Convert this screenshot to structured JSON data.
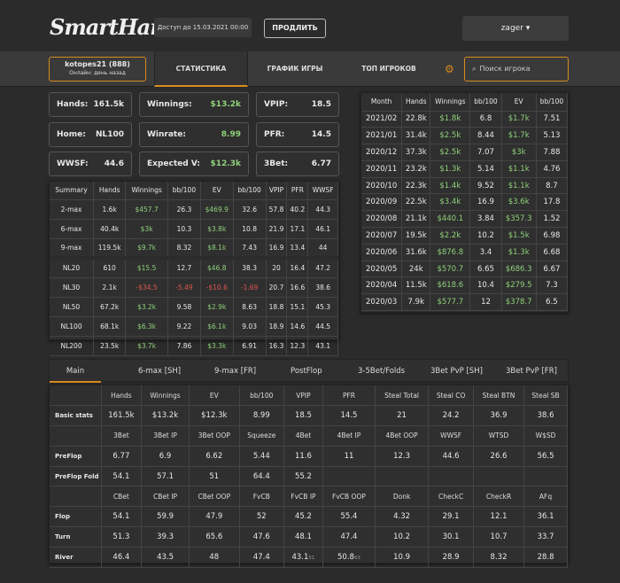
{
  "header": {
    "logo": "SmartHand",
    "access": "Доступ до 15.03.2021 00:00",
    "renew_label": "ПРОДЛИТЬ",
    "user": "zager ▾"
  },
  "nav": {
    "player_name": "kotopes21 (888)",
    "player_status": "Онлайн: день назад",
    "tabs": [
      "СТАТИСТИКА",
      "ГРАФИК ИГРЫ",
      "ТОП ИГРОКОВ"
    ],
    "search_placeholder": "Поиск игрока",
    "gear_icon": "gear-icon",
    "search_icon": "search-icon"
  },
  "stats": {
    "hands_label": "Hands:",
    "hands": "161.5k",
    "winnings_label": "Winnings:",
    "winnings": "$13.2k",
    "vpip_label": "VPIP:",
    "vpip": "18.5",
    "home_label": "Home:",
    "home": "NL100",
    "winrate_label": "Winrate:",
    "winrate": "8.99",
    "pfr_label": "PFR:",
    "pfr": "14.5",
    "wwsf_label": "WWSF:",
    "wwsf": "44.6",
    "expv_label": "Expected V:",
    "expv": "$12.3k",
    "threebet_label": "3Bet:",
    "threebet": "6.77"
  },
  "summary": {
    "headers": [
      "Summary",
      "Hands",
      "Winnings",
      "bb/100",
      "EV",
      "bb/100",
      "VPIP",
      "PFR",
      "WWSF"
    ],
    "rows": [
      [
        "2-max",
        "1.6k",
        "$457.7",
        "26.3",
        "$469.9",
        "32.6",
        "57.8",
        "40.2",
        "44.3"
      ],
      [
        "6-max",
        "40.4k",
        "$3k",
        "10.3",
        "$3.8k",
        "10.8",
        "21.9",
        "17.1",
        "46.1"
      ],
      [
        "9-max",
        "119.5k",
        "$9.7k",
        "8.32",
        "$8.1k",
        "7.43",
        "16.9",
        "13.4",
        "44"
      ],
      [
        "NL20",
        "610",
        "$15.5",
        "12.7",
        "$46.8",
        "38.3",
        "20",
        "16.4",
        "47.2"
      ],
      [
        "NL30",
        "2.1k",
        "-$34.5",
        "-5.49",
        "-$10.6",
        "-1.69",
        "20.7",
        "16.6",
        "38.6"
      ],
      [
        "NL50",
        "67.2k",
        "$3.2k",
        "9.58",
        "$2.9k",
        "8.63",
        "18.8",
        "15.1",
        "45.3"
      ],
      [
        "NL100",
        "68.1k",
        "$6.3k",
        "9.22",
        "$6.1k",
        "9.03",
        "18.9",
        "14.6",
        "44.5"
      ],
      [
        "NL200",
        "23.5k",
        "$3.7k",
        "7.86",
        "$3.3k",
        "6.91",
        "16.3",
        "12.3",
        "43.1"
      ]
    ]
  },
  "monthly": {
    "headers": [
      "Month",
      "Hands",
      "Winnings",
      "bb/100",
      "EV",
      "bb/100"
    ],
    "rows": [
      [
        "2021/02",
        "22.8k",
        "$1.8k",
        "6.8",
        "$1.7k",
        "7.51"
      ],
      [
        "2021/01",
        "31.4k",
        "$2.5k",
        "8.44",
        "$1.7k",
        "5.13"
      ],
      [
        "2020/12",
        "37.3k",
        "$2.5k",
        "7.07",
        "$3k",
        "7.88"
      ],
      [
        "2020/11",
        "23.2k",
        "$1.3k",
        "5.14",
        "$1.1k",
        "4.76"
      ],
      [
        "2020/10",
        "22.3k",
        "$1.4k",
        "9.52",
        "$1.1k",
        "8.7"
      ],
      [
        "2020/09",
        "22.5k",
        "$3.4k",
        "16.9",
        "$3.6k",
        "17.8"
      ],
      [
        "2020/08",
        "21.1k",
        "$440.1",
        "3.84",
        "$357.3",
        "1.52"
      ],
      [
        "2020/07",
        "19.5k",
        "$2.2k",
        "10.2",
        "$1.5k",
        "6.98"
      ],
      [
        "2020/06",
        "31.6k",
        "$876.8",
        "3.4",
        "$1.3k",
        "6.68"
      ],
      [
        "2020/05",
        "24k",
        "$570.7",
        "6.65",
        "$686.3",
        "6.67"
      ],
      [
        "2020/04",
        "11.5k",
        "$618.6",
        "10.4",
        "$279.5",
        "7.3"
      ],
      [
        "2020/03",
        "7.9k",
        "$577.7",
        "12",
        "$378.7",
        "6.5"
      ]
    ]
  },
  "detail": {
    "tabs": [
      "Main",
      "6-max [SH]",
      "9-max [FR]",
      "PostFlop",
      "3-5Bet/Folds",
      "3Bet PvP [SH]",
      "3Bet PvP [FR]"
    ],
    "h1": [
      "Hands",
      "Winnings",
      "EV",
      "bb/100",
      "VPIP",
      "PFR",
      "Steal Total",
      "Steal CO",
      "Steal BTN",
      "Steal SB"
    ],
    "basic_label": "Basic stats",
    "basic": [
      "161.5k",
      "$13.2k",
      "$12.3k",
      "8.99",
      "18.5",
      "14.5",
      "21",
      "24.2",
      "36.9",
      "38.6"
    ],
    "h2": [
      "3Bet",
      "3Bet IP",
      "3Bet OOP",
      "Squeeze",
      "4Bet",
      "4Bet IP",
      "4Bet OOP",
      "WWSF",
      "WTSD",
      "W$SD"
    ],
    "preflop_label": "PreFlop",
    "preflop": [
      "6.77",
      "6.9",
      "6.62",
      "5.44",
      "11.6",
      "11",
      "12.3",
      "44.6",
      "26.6",
      "56.5"
    ],
    "pffold_label": "PreFlop Fold",
    "pffold": [
      "54.1",
      "57.1",
      "51",
      "64.4",
      "55.2",
      "",
      "",
      "",
      "",
      ""
    ],
    "h3": [
      "CBet",
      "CBet IP",
      "CBet OOP",
      "FvCB",
      "FvCB IP",
      "FvCB OOP",
      "Donk",
      "CheckC",
      "CheckR",
      "AFq"
    ],
    "flop_label": "Flop",
    "flop": [
      "54.1",
      "59.9",
      "47.9",
      "52",
      "45.2",
      "55.4",
      "4.32",
      "29.1",
      "12.1",
      "36.1"
    ],
    "turn_label": "Turn",
    "turn": [
      "51.3",
      "39.3",
      "65.6",
      "47.6",
      "48.1",
      "47.4",
      "10.2",
      "30.1",
      "10.7",
      "33.7"
    ],
    "river_label": "River",
    "river": [
      "46.4",
      "43.5",
      "48",
      "47.4",
      "43.1",
      "50.8",
      "10.9",
      "28.9",
      "8.32",
      "28.8"
    ],
    "river_sub_vpip": "51",
    "river_sub_pfr": "63"
  },
  "colors": {
    "accent": "#d98a1c",
    "positive": "#8fd17a",
    "negative": "#e0574c"
  }
}
